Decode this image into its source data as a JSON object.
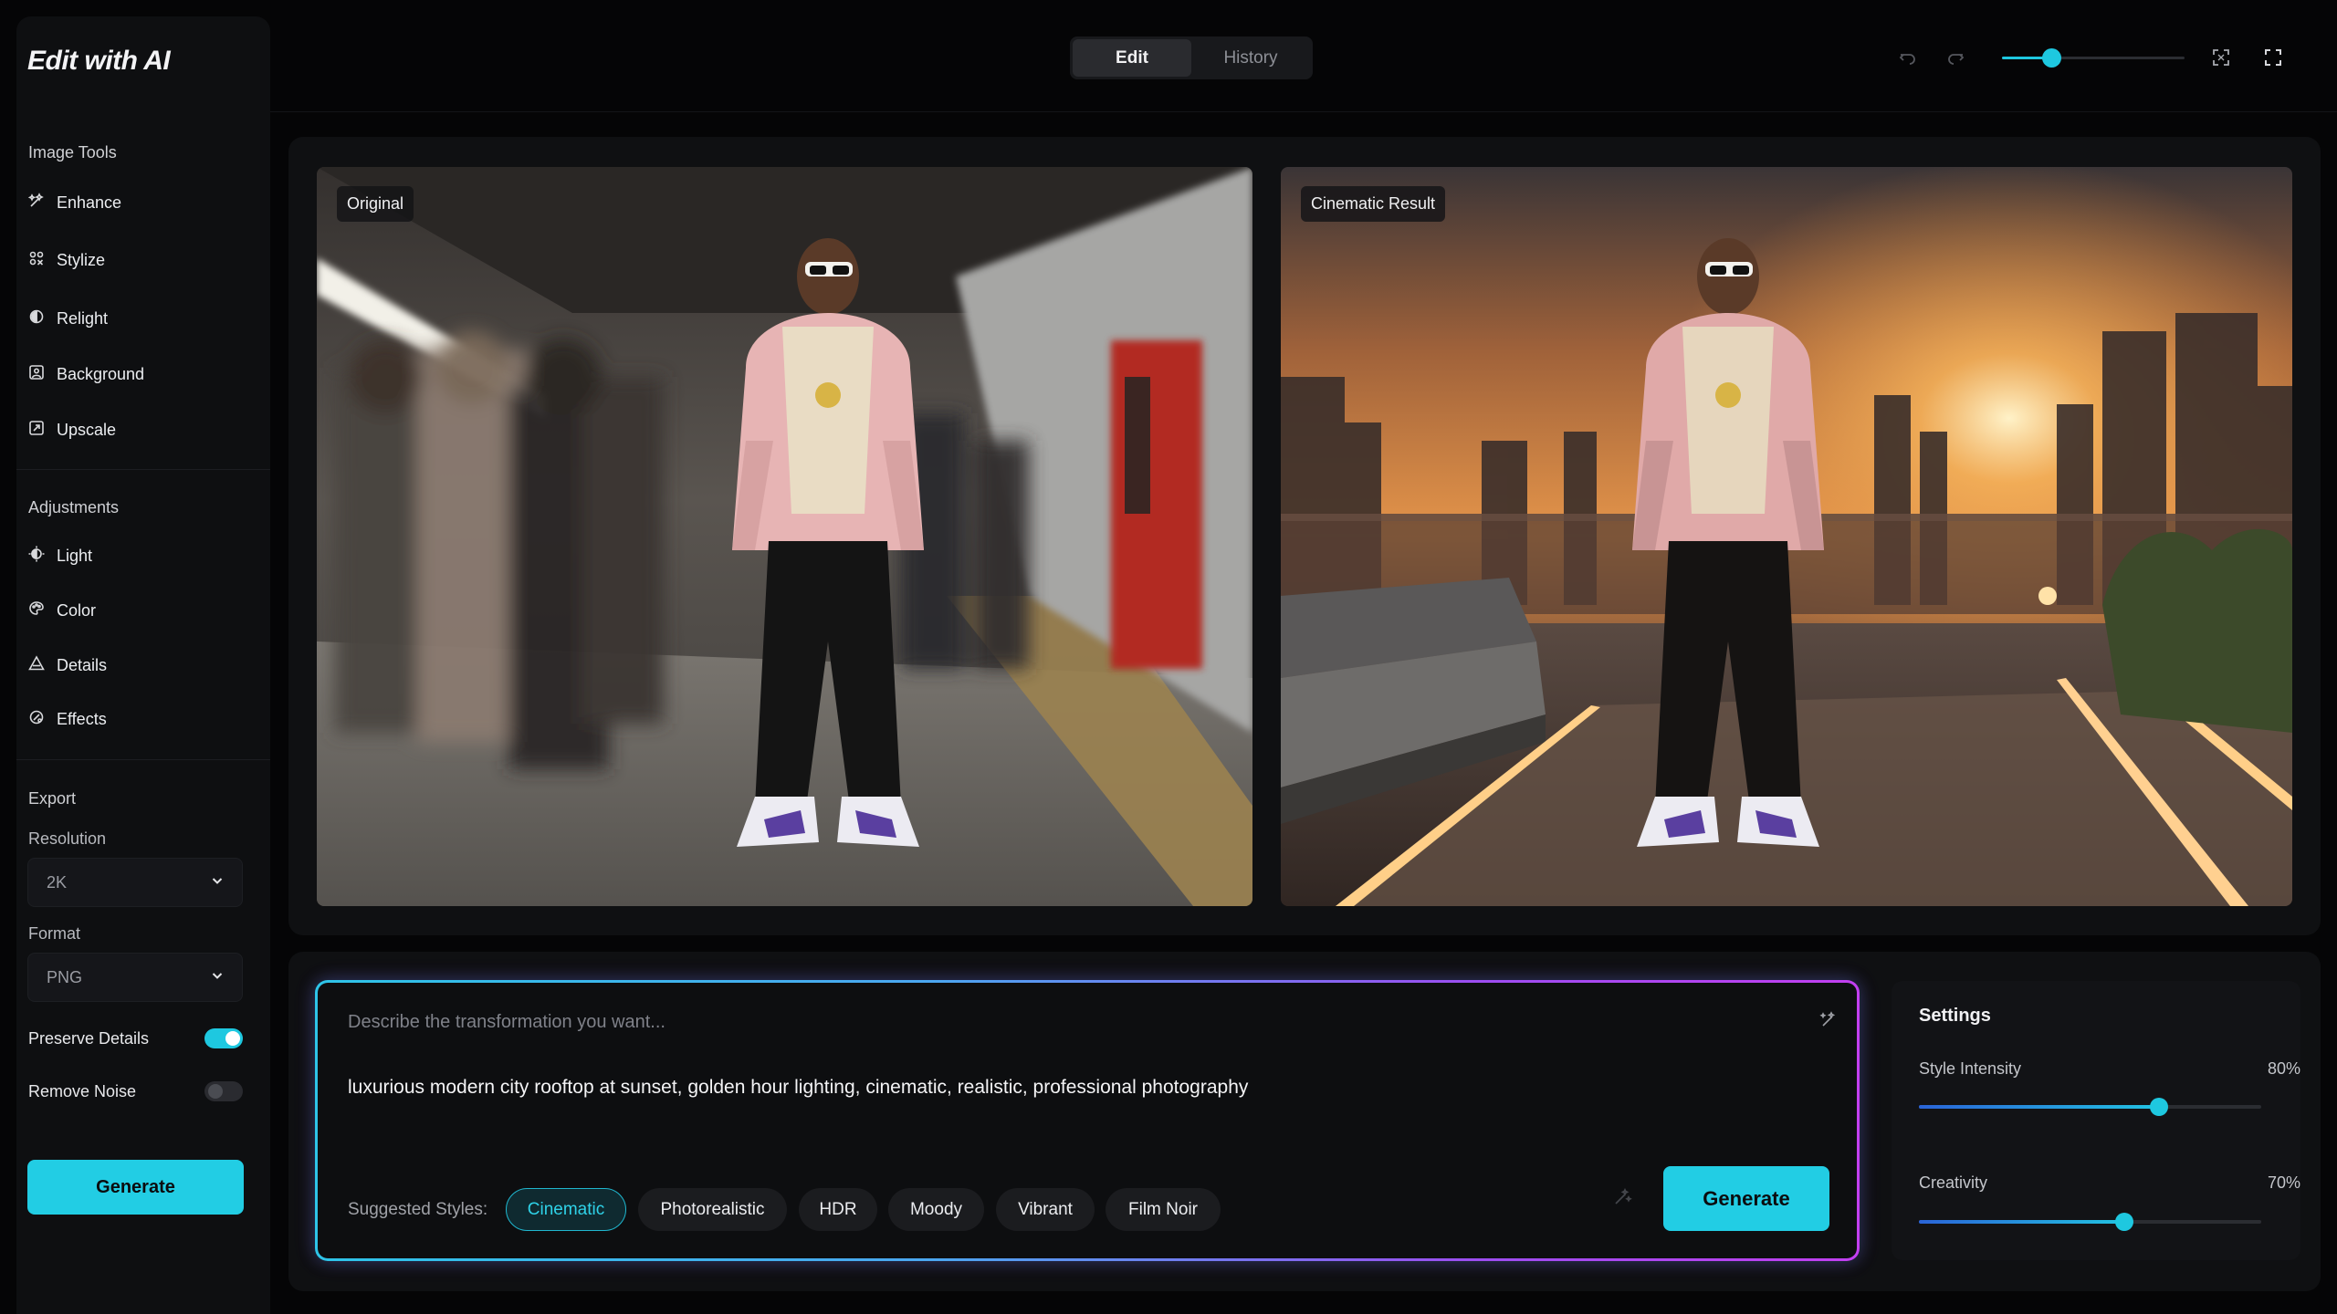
{
  "app": {
    "title": "Edit with AI"
  },
  "sidebar": {
    "image_tools_label": "Image Tools",
    "image_tools": [
      {
        "label": "Enhance",
        "icon": "enhance-icon"
      },
      {
        "label": "Stylize",
        "icon": "stylize-icon"
      },
      {
        "label": "Relight",
        "icon": "relight-icon"
      },
      {
        "label": "Background",
        "icon": "background-icon"
      },
      {
        "label": "Upscale",
        "icon": "upscale-icon"
      }
    ],
    "adjustments_label": "Adjustments",
    "adjustments": [
      {
        "label": "Light",
        "icon": "light-icon"
      },
      {
        "label": "Color",
        "icon": "color-icon"
      },
      {
        "label": "Details",
        "icon": "details-icon"
      },
      {
        "label": "Effects",
        "icon": "effects-icon"
      }
    ],
    "export": {
      "label": "Export",
      "resolution_label": "Resolution",
      "resolution_value": "2K",
      "format_label": "Format",
      "format_value": "PNG",
      "preserve_details_label": "Preserve Details",
      "preserve_details_on": true,
      "remove_noise_label": "Remove Noise",
      "remove_noise_on": false
    },
    "generate_label": "Generate"
  },
  "topbar": {
    "tabs": [
      {
        "label": "Edit",
        "active": true
      },
      {
        "label": "History",
        "active": false
      }
    ],
    "zoom_level": 0.27
  },
  "canvas": {
    "original_label": "Original",
    "result_label": "Cinematic Result"
  },
  "prompt": {
    "placeholder": "Describe the transformation you want...",
    "text": "luxurious modern city rooftop at sunset, golden hour lighting, cinematic, realistic, professional photography",
    "suggested_label": "Suggested Styles:",
    "styles": [
      "Cinematic",
      "Photorealistic",
      "HDR",
      "Moody",
      "Vibrant",
      "Film Noir"
    ],
    "active_style": "Cinematic",
    "generate_label": "Generate"
  },
  "settings": {
    "title": "Settings",
    "style_intensity_label": "Style Intensity",
    "style_intensity_value": "80%",
    "style_intensity": 0.7,
    "creativity_label": "Creativity",
    "creativity_value": "70%",
    "creativity": 0.6
  },
  "colors": {
    "accent": "#22cde4",
    "background": "#050506",
    "panel": "#0f1012"
  }
}
